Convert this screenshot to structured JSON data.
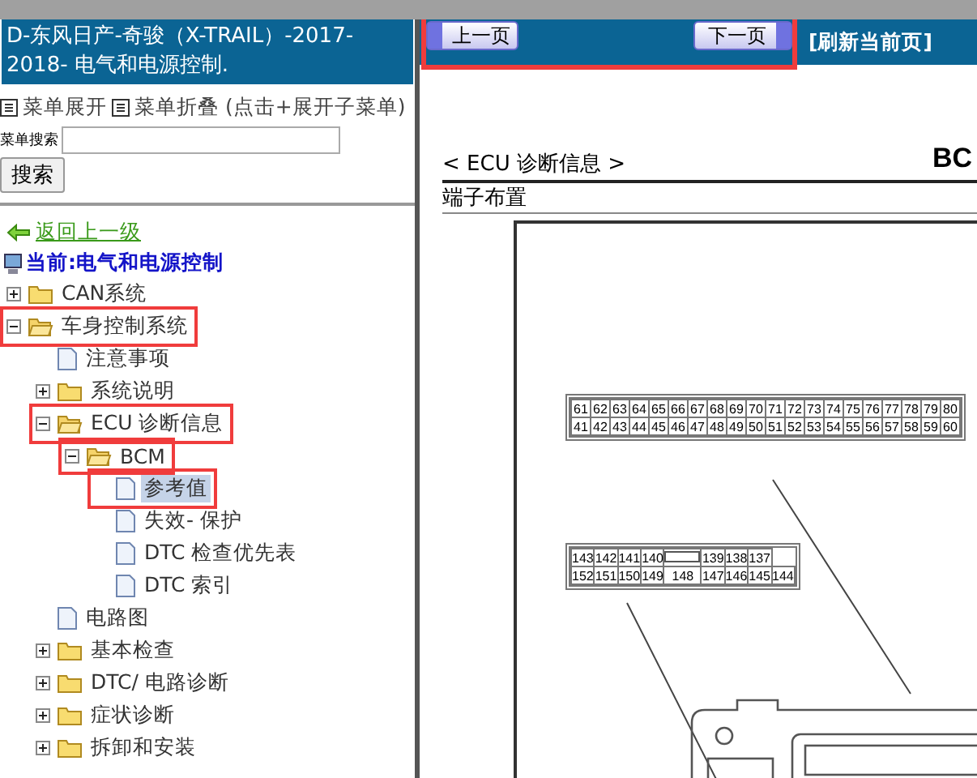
{
  "sidebar": {
    "title": "D-东风日产-奇骏（X-TRAIL）-2017-2018- 电气和电源控制.",
    "menu_actions": [
      {
        "label": "菜单展开"
      },
      {
        "label": "菜单折叠 (点击+展开子菜单)"
      }
    ],
    "search": {
      "label": "菜单搜索",
      "button": "搜索"
    },
    "back_link": "返回上一级",
    "current": "当前:电气和电源控制",
    "tree": [
      {
        "label": "CAN系统",
        "kind": "folder",
        "expanded": false,
        "selected": false,
        "highlighted": false
      },
      {
        "label": "车身控制系统",
        "kind": "folder",
        "expanded": true,
        "selected": false,
        "highlighted": true,
        "children": [
          {
            "label": "注意事项",
            "kind": "page",
            "selected": false,
            "highlighted": false
          },
          {
            "label": "系统说明",
            "kind": "folder",
            "expanded": false,
            "selected": false,
            "highlighted": false
          },
          {
            "label": "ECU 诊断信息",
            "kind": "folder",
            "expanded": true,
            "selected": false,
            "highlighted": true,
            "children": [
              {
                "label": "BCM",
                "kind": "folder",
                "expanded": true,
                "selected": false,
                "highlighted": true,
                "children": [
                  {
                    "label": "参考值",
                    "kind": "page",
                    "selected": true,
                    "highlighted": true
                  },
                  {
                    "label": "失效- 保护",
                    "kind": "page",
                    "selected": false,
                    "highlighted": false
                  },
                  {
                    "label": "DTC 检查优先表",
                    "kind": "page",
                    "selected": false,
                    "highlighted": false
                  },
                  {
                    "label": "DTC 索引",
                    "kind": "page",
                    "selected": false,
                    "highlighted": false
                  }
                ]
              }
            ]
          },
          {
            "label": "电路图",
            "kind": "page",
            "selected": false,
            "highlighted": false
          },
          {
            "label": "基本检查",
            "kind": "folder",
            "expanded": false,
            "selected": false,
            "highlighted": false
          },
          {
            "label": "DTC/ 电路诊断",
            "kind": "folder",
            "expanded": false,
            "selected": false,
            "highlighted": false
          },
          {
            "label": "症状诊断",
            "kind": "folder",
            "expanded": false,
            "selected": false,
            "highlighted": false
          },
          {
            "label": "拆卸和安装",
            "kind": "folder",
            "expanded": false,
            "selected": false,
            "highlighted": false
          }
        ]
      }
    ]
  },
  "nav": {
    "highlighted": true,
    "prev": "上一页",
    "next": "下一页",
    "refresh": "[刷新当前页]"
  },
  "document": {
    "title": "BC",
    "section": "< ECU 诊断信息 >",
    "subtitle": "端子布置",
    "connector_1": {
      "rows": [
        [
          "61",
          "62",
          "63",
          "64",
          "65",
          "66",
          "67",
          "68",
          "69",
          "70",
          "71",
          "72",
          "73",
          "74",
          "75",
          "76",
          "77",
          "78",
          "79",
          "80"
        ],
        [
          "41",
          "42",
          "43",
          "44",
          "45",
          "46",
          "47",
          "48",
          "49",
          "50",
          "51",
          "52",
          "53",
          "54",
          "55",
          "56",
          "57",
          "58",
          "59",
          "60"
        ]
      ]
    },
    "connector_2": {
      "rows": [
        [
          "143",
          "142",
          "141",
          "140",
          "",
          "139",
          "138",
          "137"
        ],
        [
          "152",
          "151",
          "150",
          "149",
          "148",
          "147",
          "146",
          "145",
          "144"
        ]
      ]
    }
  }
}
